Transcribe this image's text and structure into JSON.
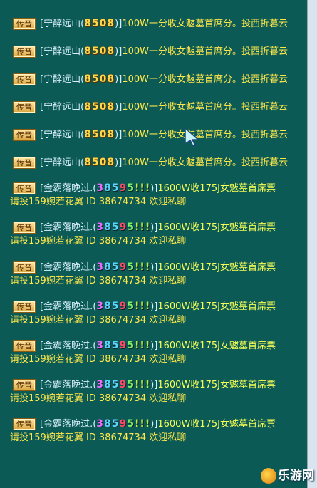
{
  "chat": {
    "messages_a": [
      {
        "tag": "传音",
        "open": "[",
        "name": "宁醉远山",
        "id_open": "(",
        "id": "8508",
        "id_close": ")",
        "close": "]",
        "text": "100W一分收女魃墓首席分。",
        "text2": "投西折暮云"
      },
      {
        "tag": "传音",
        "open": "[",
        "name": "宁醉远山",
        "id_open": "(",
        "id": "8508",
        "id_close": ")",
        "close": "]",
        "text": "100W一分收女魃墓首席分。",
        "text2": "投西折暮云"
      },
      {
        "tag": "传音",
        "open": "[",
        "name": "宁醉远山",
        "id_open": "(",
        "id": "8508",
        "id_close": ")",
        "close": "]",
        "text": "100W一分收女魃墓首席分。",
        "text2": "投西折暮云"
      },
      {
        "tag": "传音",
        "open": "[",
        "name": "宁醉远山",
        "id_open": "(",
        "id": "8508",
        "id_close": ")",
        "close": "]",
        "text": "100W一分收女魃墓首席分。",
        "text2": "投西折暮云"
      },
      {
        "tag": "传音",
        "open": "[",
        "name": "宁醉远山",
        "id_open": "(",
        "id": "8508",
        "id_close": ")",
        "close": "]",
        "text": "100W一分收女魃墓首席分。",
        "text2": "投西折暮云"
      },
      {
        "tag": "传音",
        "open": "[",
        "name": "宁醉远山",
        "id_open": "(",
        "id": "8508",
        "id_close": ")",
        "close": "]",
        "text": "100W一分收女魃墓首席分。",
        "text2": "投西折暮云"
      }
    ],
    "messages_b": [
      {
        "tag": "传音",
        "open": "[",
        "name": "金霸落晚过.",
        "id_open": "(",
        "d1": "3",
        "d2": "8",
        "d3": "5",
        "d4": "9",
        "d5": "5",
        "d6": "!!!",
        "id_close": ")",
        "close": "]",
        "text": "1600W收175J女魃墓首席票",
        "line2": "请投159婉若花翼 ID 38674734 欢迎私聊"
      },
      {
        "tag": "传音",
        "open": "[",
        "name": "金霸落晚过.",
        "id_open": "(",
        "d1": "3",
        "d2": "8",
        "d3": "5",
        "d4": "9",
        "d5": "5",
        "d6": "!!!",
        "id_close": ")",
        "close": "]",
        "text": "1600W收175J女魃墓首席票",
        "line2": "请投159婉若花翼 ID 38674734 欢迎私聊"
      },
      {
        "tag": "传音",
        "open": "[",
        "name": "金霸落晚过.",
        "id_open": "(",
        "d1": "3",
        "d2": "8",
        "d3": "5",
        "d4": "9",
        "d5": "5",
        "d6": "!!!",
        "id_close": ")",
        "close": "]",
        "text": "1600W收175J女魃墓首席票",
        "line2": "请投159婉若花翼 ID 38674734 欢迎私聊"
      },
      {
        "tag": "传音",
        "open": "[",
        "name": "金霸落晚过.",
        "id_open": "(",
        "d1": "3",
        "d2": "8",
        "d3": "5",
        "d4": "9",
        "d5": "5",
        "d6": "!!!",
        "id_close": ")",
        "close": "]",
        "text": "1600W收175J女魃墓首席票",
        "line2": "请投159婉若花翼 ID 38674734 欢迎私聊"
      },
      {
        "tag": "传音",
        "open": "[",
        "name": "金霸落晚过.",
        "id_open": "(",
        "d1": "3",
        "d2": "8",
        "d3": "5",
        "d4": "9",
        "d5": "5",
        "d6": "!!!",
        "id_close": ")",
        "close": "]",
        "text": "1600W收175J女魃墓首席票",
        "line2": "请投159婉若花翼 ID 38674734 欢迎私聊"
      },
      {
        "tag": "传音",
        "open": "[",
        "name": "金霸落晚过.",
        "id_open": "(",
        "d1": "3",
        "d2": "8",
        "d3": "5",
        "d4": "9",
        "d5": "5",
        "d6": "!!!",
        "id_close": ")",
        "close": "]",
        "text": "1600W收175J女魃墓首席票",
        "line2": "请投159婉若花翼 ID 38674734 欢迎私聊"
      },
      {
        "tag": "传音",
        "open": "[",
        "name": "金霸落晚过.",
        "id_open": "(",
        "d1": "3",
        "d2": "8",
        "d3": "5",
        "d4": "9",
        "d5": "5",
        "d6": "!!!",
        "id_close": ")",
        "close": "]",
        "text": "1600W收175J女魃墓首席票",
        "line2": "请投159婉若花翼 ID 38674734 欢迎私聊"
      }
    ]
  },
  "watermark": {
    "text": "乐游网"
  },
  "colors": {
    "background": "#0c5a56",
    "tag_bg": "#f3cf6c",
    "id_gold": "#ffd84a",
    "text_yellow": "#ffe84a"
  }
}
